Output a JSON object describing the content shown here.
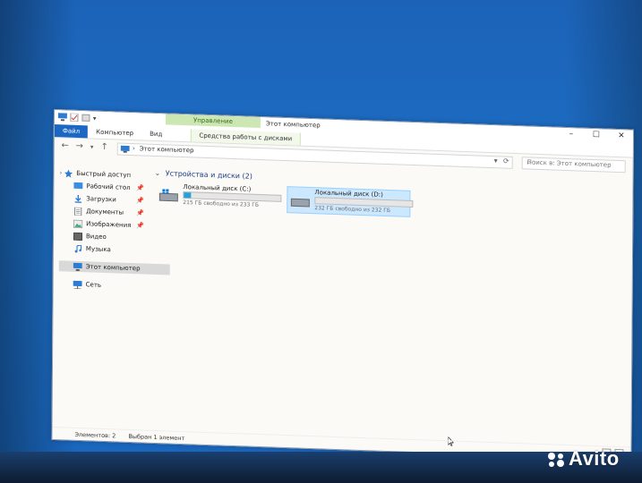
{
  "window": {
    "title": "Этот компьютер",
    "context_group": "Управление"
  },
  "ribbon": {
    "tabs": [
      "Файл",
      "Компьютер",
      "Вид",
      "Средства работы с дисками"
    ]
  },
  "address": {
    "crumb": "Этот компьютер",
    "search_placeholder": "Поиск в: Этот компьютер"
  },
  "nav": {
    "items": [
      {
        "label": "Быстрый доступ",
        "icon": "star-icon"
      },
      {
        "label": "Рабочий стол",
        "icon": "desktop-icon",
        "pinned": true
      },
      {
        "label": "Загрузки",
        "icon": "download-icon",
        "pinned": true
      },
      {
        "label": "Документы",
        "icon": "documents-icon",
        "pinned": true
      },
      {
        "label": "Изображения",
        "icon": "images-icon",
        "pinned": true
      },
      {
        "label": "Видео",
        "icon": "video-icon"
      },
      {
        "label": "Музыка",
        "icon": "music-icon"
      },
      {
        "label": "Этот компьютер",
        "icon": "pc-icon",
        "selected": true
      },
      {
        "label": "Сеть",
        "icon": "network-icon"
      }
    ]
  },
  "group": {
    "title": "Устройства и диски (2)"
  },
  "drives": [
    {
      "name": "Локальный диск (C:)",
      "free": "215 ГБ свободно из 233 ГБ",
      "used_fraction": 0.077,
      "selected": false
    },
    {
      "name": "Локальный диск (D:)",
      "free": "232 ГБ свободно из 232 ГБ",
      "used_fraction": 0.0,
      "selected": true
    }
  ],
  "status": {
    "items_count": "Элементов: 2",
    "selected": "Выбран 1 элемент"
  },
  "watermark": "Avito",
  "colors": {
    "accent": "#1a67c4",
    "context_tab": "#cde7b4",
    "selection": "#cce8ff",
    "drive_fill": "#26a0da"
  }
}
